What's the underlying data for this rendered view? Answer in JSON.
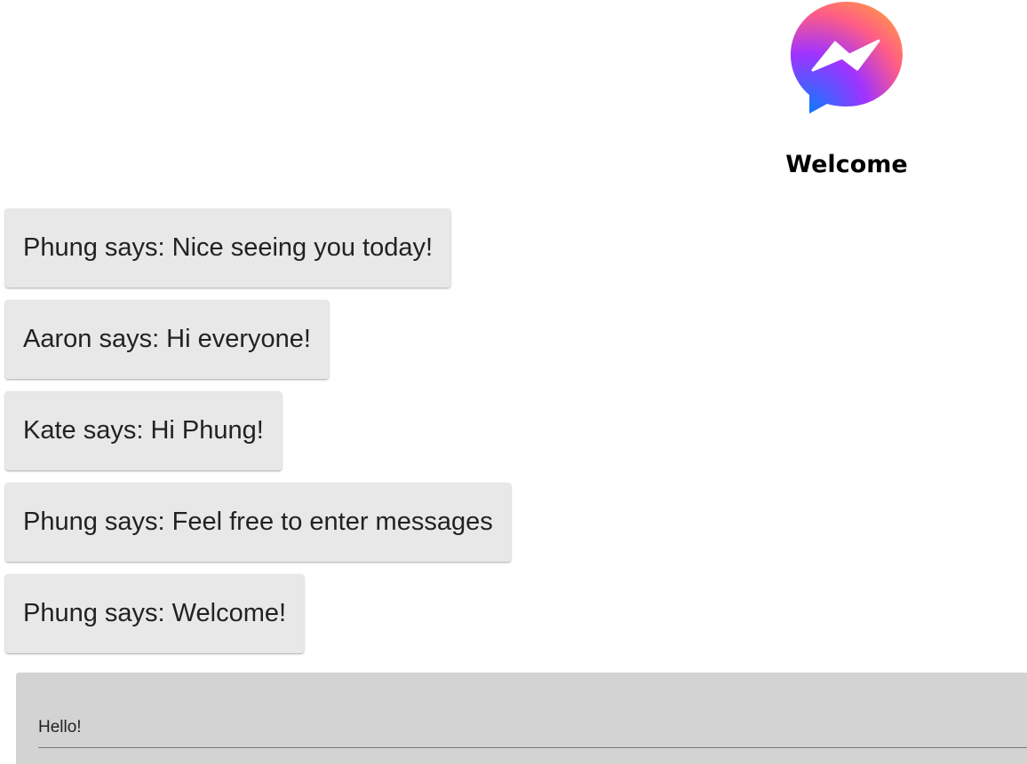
{
  "header": {
    "logo_icon": "messenger-logo-icon",
    "title": "Welcome"
  },
  "messages": [
    {
      "text": "Phung says: Nice seeing you today!"
    },
    {
      "text": "Aaron says: Hi everyone!"
    },
    {
      "text": "Kate says: Hi Phung!"
    },
    {
      "text": "Phung says: Feel free to enter messages"
    },
    {
      "text": "Phung says: Welcome!"
    }
  ],
  "composer": {
    "value": "Hello!"
  },
  "colors": {
    "message_bg": "#e8e8e8",
    "composer_bg": "#d3d3d3",
    "logo_gradient": [
      "#0a7cff",
      "#a033ff",
      "#ff5c87"
    ]
  }
}
